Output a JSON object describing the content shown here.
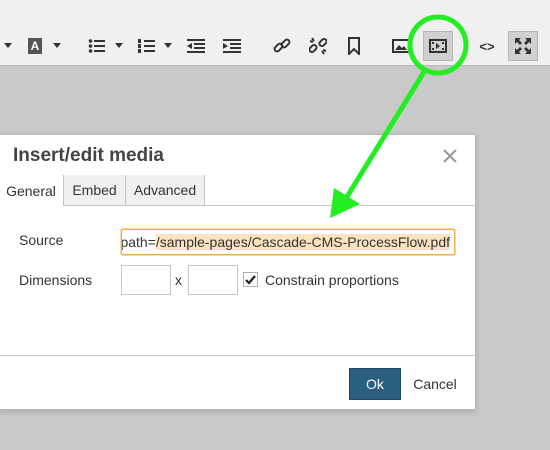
{
  "toolbar": {
    "buttons": [
      {
        "icon": "text-color-icon"
      },
      {
        "icon": "bullet-list-icon"
      },
      {
        "icon": "numbered-list-icon"
      },
      {
        "icon": "decrease-indent-icon"
      },
      {
        "icon": "increase-indent-icon"
      },
      {
        "icon": "link-icon"
      },
      {
        "icon": "unlink-icon"
      },
      {
        "icon": "bookmark-icon"
      },
      {
        "icon": "image-icon"
      },
      {
        "icon": "media-icon",
        "active": true
      },
      {
        "icon": "source-code-icon"
      },
      {
        "icon": "fullscreen-icon"
      }
    ],
    "text_color_glyph": "A",
    "source_code_glyph": "<>"
  },
  "dialog": {
    "title": "Insert/edit media",
    "tabs": [
      {
        "label": "General",
        "active": true
      },
      {
        "label": "Embed",
        "active": false
      },
      {
        "label": "Advanced",
        "active": false
      }
    ],
    "source": {
      "label": "Source",
      "value_prefix": "t?path=",
      "value_highlight": "/sample-pages/Cascade-CMS-ProcessFlow.pdf"
    },
    "dimensions": {
      "label": "Dimensions",
      "width_value": "",
      "height_value": "",
      "separator": "x"
    },
    "constrain": {
      "label": "Constrain proportions",
      "checked": true
    },
    "ok_label": "Ok",
    "cancel_label": "Cancel"
  },
  "colors": {
    "annotation": "#22ee22",
    "ok_button": "#2b5f82",
    "input_focus": "#f0a850",
    "highlight": "#fbe3c0"
  }
}
